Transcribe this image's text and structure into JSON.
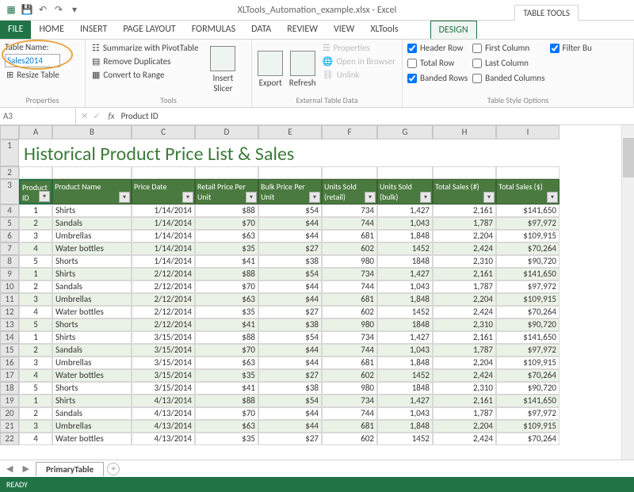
{
  "app": {
    "title": "XLTools_Automation_example.xlsx - Excel",
    "tableToolsLabel": "TABLE TOOLS"
  },
  "tabs": {
    "file": "FILE",
    "home": "HOME",
    "insert": "INSERT",
    "pageLayout": "PAGE LAYOUT",
    "formulas": "FORMULAS",
    "data": "DATA",
    "review": "REVIEW",
    "view": "VIEW",
    "xltools": "XLTools",
    "design": "DESIGN"
  },
  "ribbon": {
    "properties": {
      "groupTitle": "Properties",
      "tableNameLabel": "Table Name:",
      "tableNameValue": "Sales2014",
      "resize": "Resize Table"
    },
    "tools": {
      "groupTitle": "Tools",
      "pivot": "Summarize with PivotTable",
      "dup": "Remove Duplicates",
      "range": "Convert to Range",
      "slicer": "Insert\nSlicer"
    },
    "ext": {
      "groupTitle": "External Table Data",
      "export": "Export",
      "refresh": "Refresh",
      "props": "Properties",
      "browser": "Open in Browser",
      "unlink": "Unlink"
    },
    "opts": {
      "groupTitle": "Table Style Options",
      "headerRow": "Header Row",
      "totalRow": "Total Row",
      "bandedRows": "Banded Rows",
      "firstCol": "First Column",
      "lastCol": "Last Column",
      "bandedCols": "Banded Columns",
      "filterBtn": "Filter Bu"
    }
  },
  "formulaBar": {
    "nameBox": "A3",
    "fx": "fx",
    "value": "Product ID"
  },
  "sheetTitle": "Historical Product Price List & Sales",
  "columns": [
    "",
    "A",
    "B",
    "C",
    "D",
    "E",
    "F",
    "G",
    "H",
    "I"
  ],
  "headers": [
    "Product ID",
    "Product Name",
    "Price Date",
    "Retail Price Per Unit",
    "Bulk Price Per Unit",
    "Units Sold (retail)",
    "Units Sold (bulk)",
    "Total Sales (#)",
    "Total Sales ($)"
  ],
  "rows": [
    {
      "n": 4,
      "id": 1,
      "name": "Shirts",
      "date": "1/14/2014",
      "rp": "$88",
      "bp": "$54",
      "ur": "734",
      "ub": "1,427",
      "tn": "2,161",
      "ts": "$141,650"
    },
    {
      "n": 5,
      "id": 2,
      "name": "Sandals",
      "date": "1/14/2014",
      "rp": "$70",
      "bp": "$44",
      "ur": "744",
      "ub": "1,043",
      "tn": "1,787",
      "ts": "$97,972"
    },
    {
      "n": 6,
      "id": 3,
      "name": "Umbrellas",
      "date": "1/14/2014",
      "rp": "$63",
      "bp": "$44",
      "ur": "681",
      "ub": "1,848",
      "tn": "2,204",
      "ts": "$109,915"
    },
    {
      "n": 7,
      "id": 4,
      "name": "Water bottles",
      "date": "1/14/2014",
      "rp": "$35",
      "bp": "$27",
      "ur": "602",
      "ub": "1452",
      "tn": "2,424",
      "ts": "$70,264"
    },
    {
      "n": 8,
      "id": 5,
      "name": "Shorts",
      "date": "1/14/2014",
      "rp": "$41",
      "bp": "$38",
      "ur": "980",
      "ub": "1848",
      "tn": "2,310",
      "ts": "$90,720"
    },
    {
      "n": 9,
      "id": 1,
      "name": "Shirts",
      "date": "2/12/2014",
      "rp": "$88",
      "bp": "$54",
      "ur": "734",
      "ub": "1,427",
      "tn": "2,161",
      "ts": "$141,650"
    },
    {
      "n": 10,
      "id": 2,
      "name": "Sandals",
      "date": "2/12/2014",
      "rp": "$70",
      "bp": "$44",
      "ur": "744",
      "ub": "1,043",
      "tn": "1,787",
      "ts": "$97,972"
    },
    {
      "n": 11,
      "id": 3,
      "name": "Umbrellas",
      "date": "2/12/2014",
      "rp": "$63",
      "bp": "$44",
      "ur": "681",
      "ub": "1,848",
      "tn": "2,204",
      "ts": "$109,915"
    },
    {
      "n": 12,
      "id": 4,
      "name": "Water bottles",
      "date": "2/12/2014",
      "rp": "$35",
      "bp": "$27",
      "ur": "602",
      "ub": "1452",
      "tn": "2,424",
      "ts": "$70,264"
    },
    {
      "n": 13,
      "id": 5,
      "name": "Shorts",
      "date": "2/12/2014",
      "rp": "$41",
      "bp": "$38",
      "ur": "980",
      "ub": "1848",
      "tn": "2,310",
      "ts": "$90,720"
    },
    {
      "n": 14,
      "id": 1,
      "name": "Shirts",
      "date": "3/15/2014",
      "rp": "$88",
      "bp": "$54",
      "ur": "734",
      "ub": "1,427",
      "tn": "2,161",
      "ts": "$141,650"
    },
    {
      "n": 15,
      "id": 2,
      "name": "Sandals",
      "date": "3/15/2014",
      "rp": "$70",
      "bp": "$44",
      "ur": "744",
      "ub": "1,043",
      "tn": "1,787",
      "ts": "$97,972"
    },
    {
      "n": 16,
      "id": 3,
      "name": "Umbrellas",
      "date": "3/15/2014",
      "rp": "$63",
      "bp": "$44",
      "ur": "681",
      "ub": "1,848",
      "tn": "2,204",
      "ts": "$109,915"
    },
    {
      "n": 17,
      "id": 4,
      "name": "Water bottles",
      "date": "3/15/2014",
      "rp": "$35",
      "bp": "$27",
      "ur": "602",
      "ub": "1452",
      "tn": "2,424",
      "ts": "$70,264"
    },
    {
      "n": 18,
      "id": 5,
      "name": "Shorts",
      "date": "3/15/2014",
      "rp": "$41",
      "bp": "$38",
      "ur": "980",
      "ub": "1848",
      "tn": "2,310",
      "ts": "$90,720"
    },
    {
      "n": 19,
      "id": 1,
      "name": "Shirts",
      "date": "4/13/2014",
      "rp": "$88",
      "bp": "$54",
      "ur": "734",
      "ub": "1,427",
      "tn": "2,161",
      "ts": "$141,650"
    },
    {
      "n": 20,
      "id": 2,
      "name": "Sandals",
      "date": "4/13/2014",
      "rp": "$70",
      "bp": "$44",
      "ur": "744",
      "ub": "1,043",
      "tn": "1,787",
      "ts": "$97,972"
    },
    {
      "n": 21,
      "id": 3,
      "name": "Umbrellas",
      "date": "4/13/2014",
      "rp": "$63",
      "bp": "$44",
      "ur": "681",
      "ub": "1,848",
      "tn": "2,204",
      "ts": "$109,915"
    },
    {
      "n": 22,
      "id": 4,
      "name": "Water bottles",
      "date": "4/13/2014",
      "rp": "$35",
      "bp": "$27",
      "ur": "602",
      "ub": "1452",
      "tn": "2,424",
      "ts": "$70,264"
    }
  ],
  "sheet": {
    "name": "PrimaryTable"
  },
  "status": {
    "ready": "READY"
  }
}
